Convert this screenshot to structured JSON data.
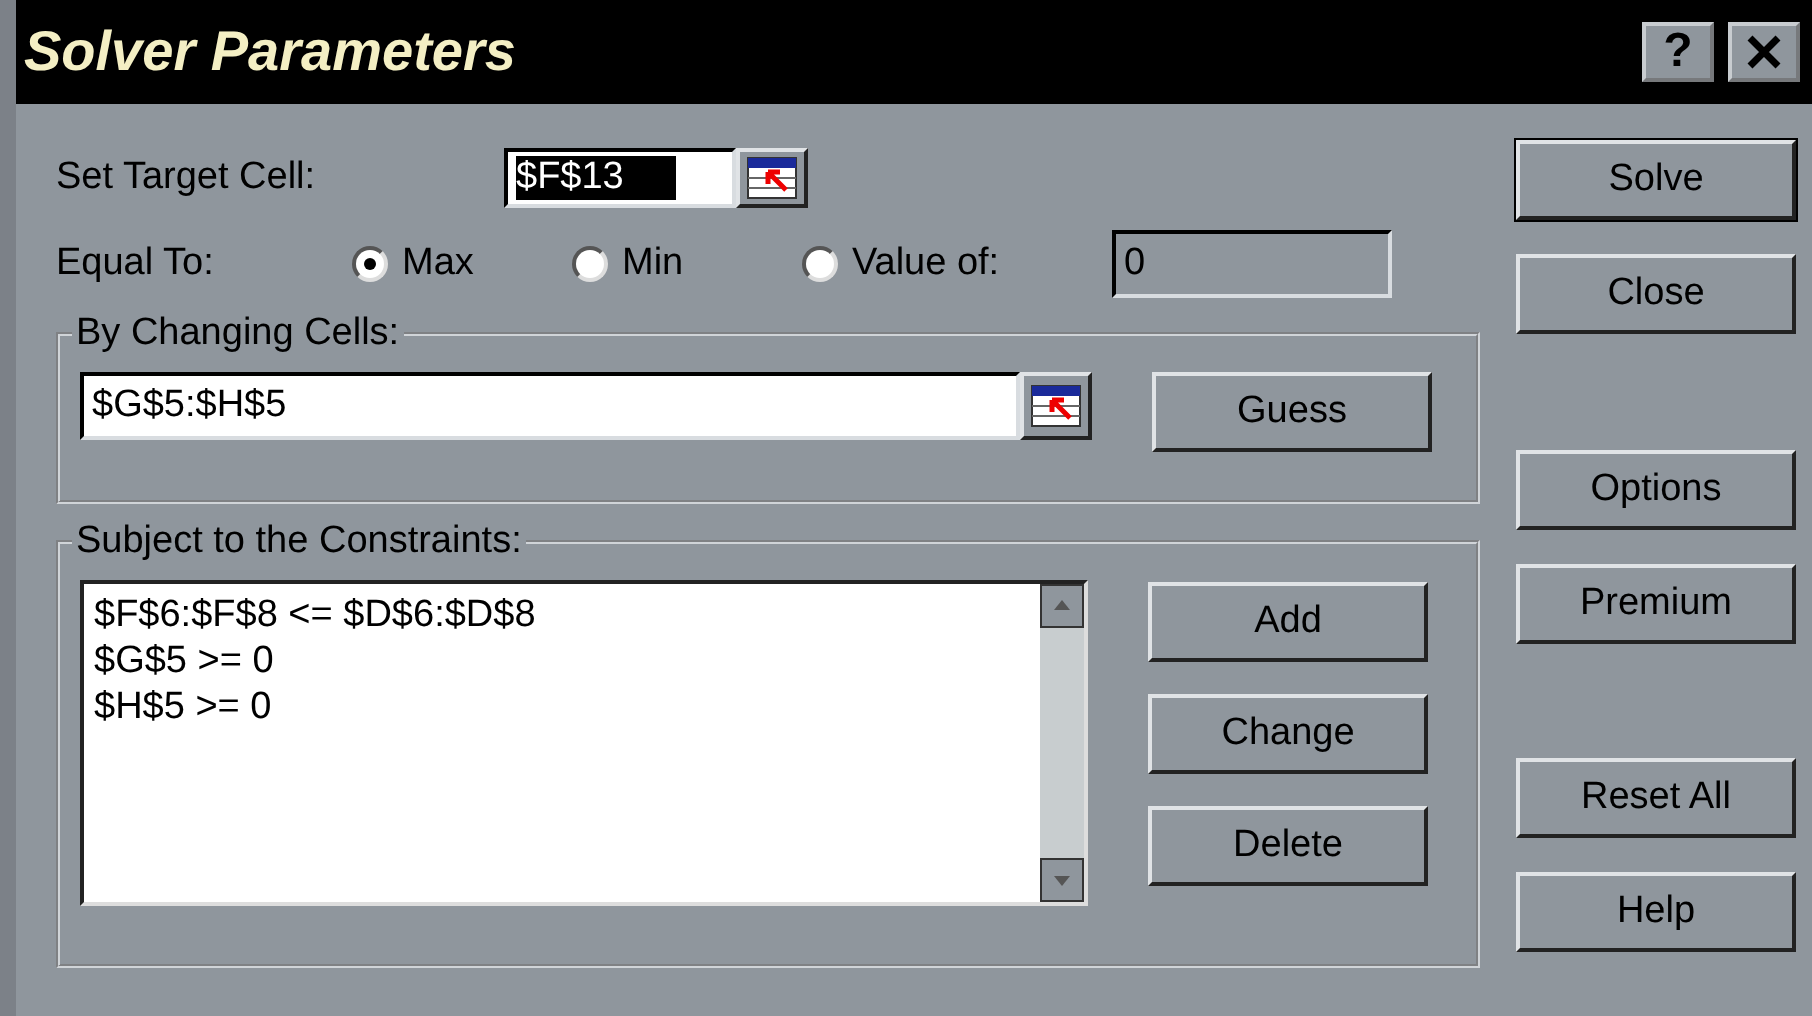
{
  "window": {
    "title": "Solver Parameters",
    "help_label": "?"
  },
  "target": {
    "label": "Set Target Cell:",
    "value": "$F$13",
    "value_selected": true
  },
  "equal_to": {
    "label": "Equal To:",
    "options": [
      {
        "label": "Max",
        "selected": true
      },
      {
        "label": "Min",
        "selected": false
      },
      {
        "label": "Value of:",
        "selected": false
      }
    ],
    "value_of": "0"
  },
  "changing_cells": {
    "label": "By Changing Cells:",
    "value": "$G$5:$H$5",
    "button": {
      "label": "Guess"
    }
  },
  "constraints": {
    "label": "Subject to the Constraints:",
    "items": [
      "$F$6:$F$8 <= $D$6:$D$8",
      "$G$5 >= 0",
      "$H$5 >= 0"
    ],
    "buttons": [
      {
        "label": "Add"
      },
      {
        "label": "Change"
      },
      {
        "label": "Delete"
      }
    ]
  },
  "side_button_groups": [
    [
      {
        "label": "Solve",
        "default": true
      },
      {
        "label": "Close",
        "default": false
      }
    ],
    [
      {
        "label": "Options",
        "default": false
      },
      {
        "label": "Premium",
        "default": false
      }
    ],
    [
      {
        "label": "Reset All",
        "default": false
      },
      {
        "label": "Help",
        "default": false
      }
    ]
  ]
}
